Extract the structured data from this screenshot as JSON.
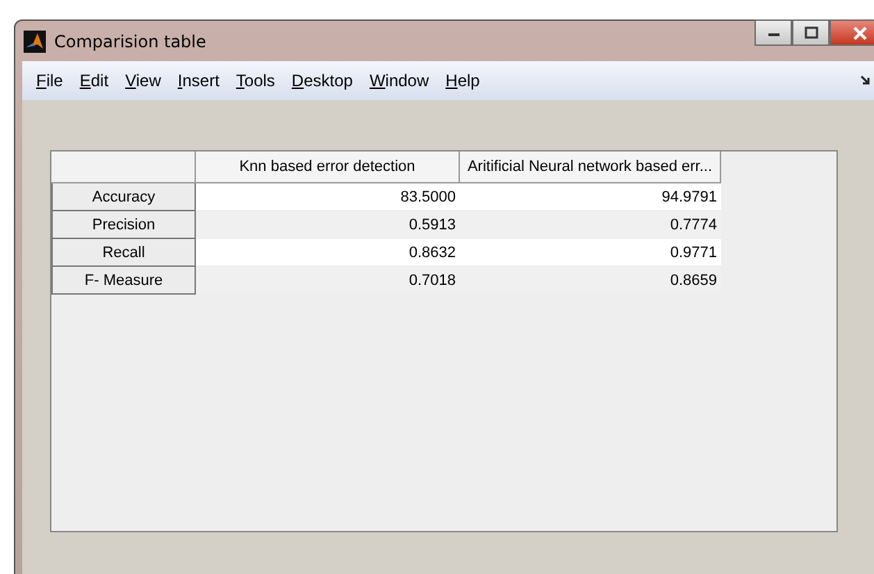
{
  "window": {
    "title": "Comparision table"
  },
  "menu": [
    {
      "label": "File"
    },
    {
      "label": "Edit"
    },
    {
      "label": "View"
    },
    {
      "label": "Insert"
    },
    {
      "label": "Tools"
    },
    {
      "label": "Desktop"
    },
    {
      "label": "Window"
    },
    {
      "label": "Help"
    }
  ],
  "table": {
    "columns": [
      "Knn based error detection",
      "Aritificial Neural network based err..."
    ],
    "rows": [
      {
        "header": "Accuracy",
        "cells": [
          "83.5000",
          "94.9791"
        ]
      },
      {
        "header": "Precision",
        "cells": [
          "0.5913",
          "0.7774"
        ]
      },
      {
        "header": "Recall",
        "cells": [
          "0.8632",
          "0.9771"
        ]
      },
      {
        "header": "F- Measure",
        "cells": [
          "0.7018",
          "0.8659"
        ]
      }
    ]
  }
}
